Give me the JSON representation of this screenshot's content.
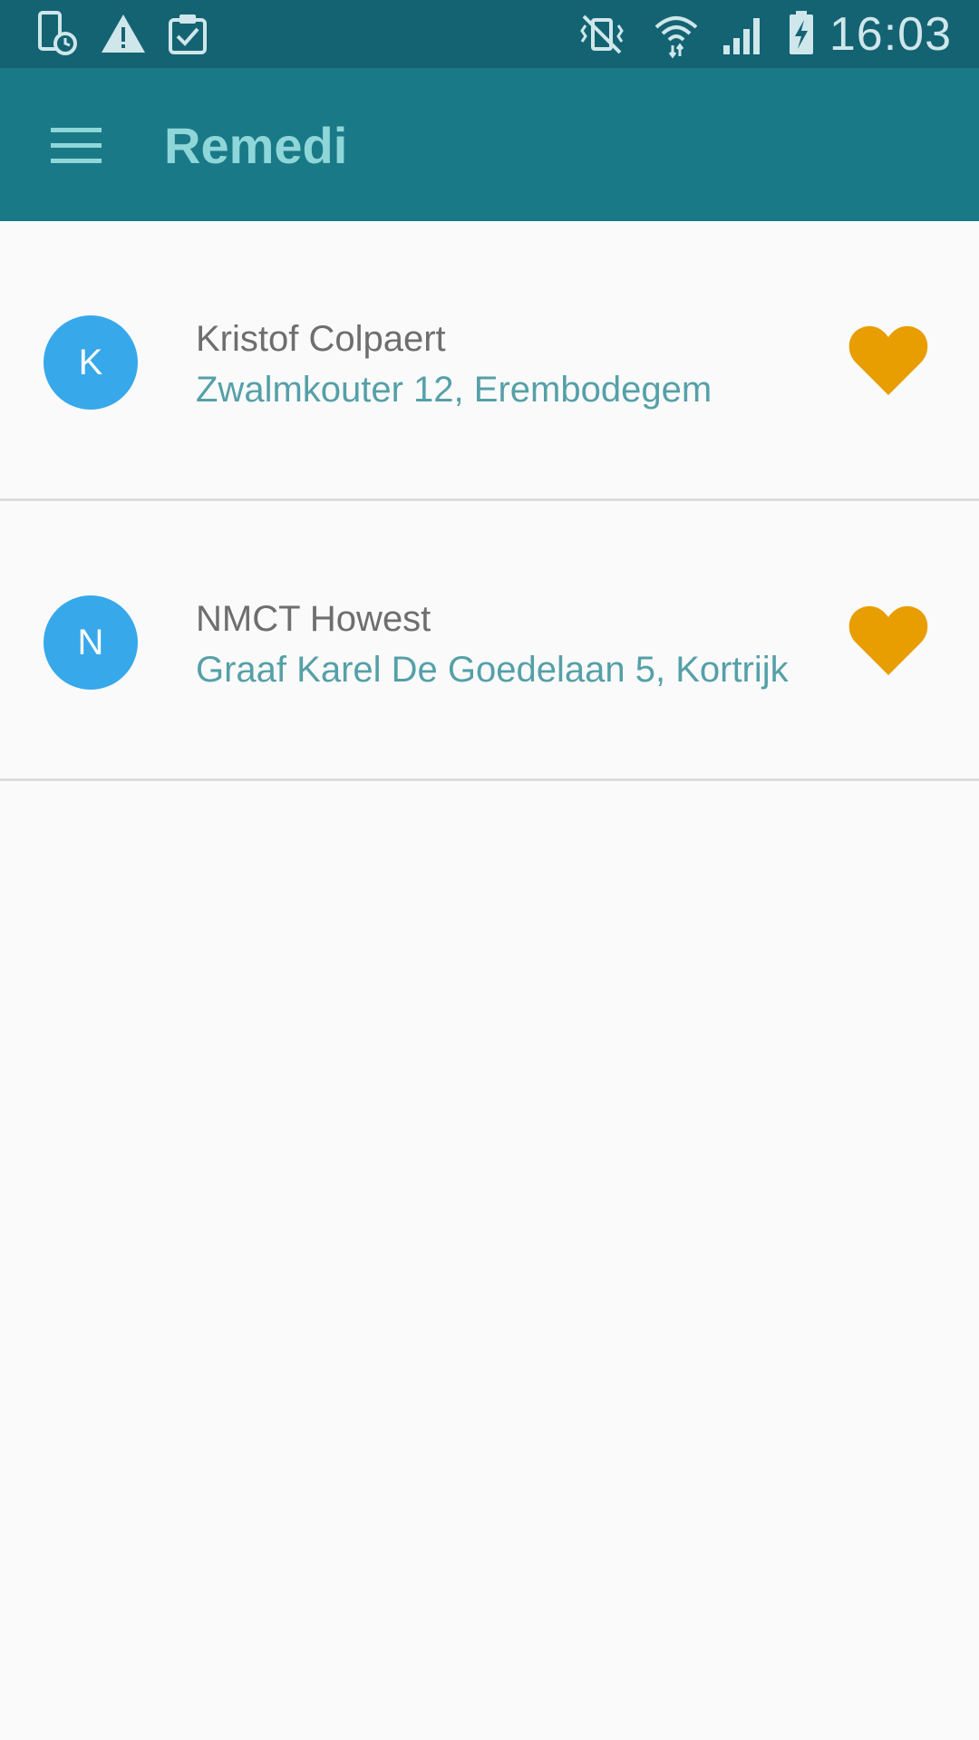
{
  "status_bar": {
    "time": "16:03",
    "left_icons": [
      "phone-clock-icon",
      "warning-icon",
      "clipboard-check-icon"
    ],
    "right_icons": [
      "vibrate-mute-icon",
      "wifi-icon",
      "signal-icon",
      "battery-charging-icon"
    ]
  },
  "app_bar": {
    "title": "Remedi",
    "menu_icon": "hamburger-menu-icon"
  },
  "colors": {
    "status_bar": "#136373",
    "app_bar": "#1a7987",
    "title": "#8fd6d9",
    "avatar": "#37a8ea",
    "favorite": "#e89d00",
    "address": "#55a0a8"
  },
  "contacts": [
    {
      "initial": "K",
      "name": "Kristof Colpaert",
      "address": "Zwalmkouter 12, Erembodegem",
      "favorite": true
    },
    {
      "initial": "N",
      "name": "NMCT Howest",
      "address": "Graaf Karel De Goedelaan 5, Kortrijk",
      "favorite": true
    }
  ]
}
